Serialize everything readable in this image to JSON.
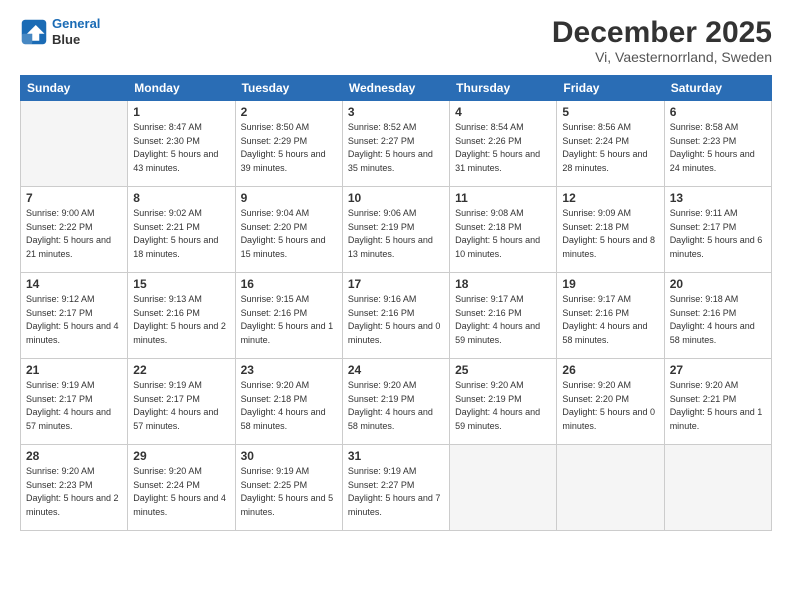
{
  "header": {
    "logo_line1": "General",
    "logo_line2": "Blue",
    "month": "December 2025",
    "location": "Vi, Vaesternorrland, Sweden"
  },
  "weekdays": [
    "Sunday",
    "Monday",
    "Tuesday",
    "Wednesday",
    "Thursday",
    "Friday",
    "Saturday"
  ],
  "weeks": [
    [
      {
        "day": "",
        "sunrise": "",
        "sunset": "",
        "daylight": ""
      },
      {
        "day": "1",
        "sunrise": "Sunrise: 8:47 AM",
        "sunset": "Sunset: 2:30 PM",
        "daylight": "Daylight: 5 hours and 43 minutes."
      },
      {
        "day": "2",
        "sunrise": "Sunrise: 8:50 AM",
        "sunset": "Sunset: 2:29 PM",
        "daylight": "Daylight: 5 hours and 39 minutes."
      },
      {
        "day": "3",
        "sunrise": "Sunrise: 8:52 AM",
        "sunset": "Sunset: 2:27 PM",
        "daylight": "Daylight: 5 hours and 35 minutes."
      },
      {
        "day": "4",
        "sunrise": "Sunrise: 8:54 AM",
        "sunset": "Sunset: 2:26 PM",
        "daylight": "Daylight: 5 hours and 31 minutes."
      },
      {
        "day": "5",
        "sunrise": "Sunrise: 8:56 AM",
        "sunset": "Sunset: 2:24 PM",
        "daylight": "Daylight: 5 hours and 28 minutes."
      },
      {
        "day": "6",
        "sunrise": "Sunrise: 8:58 AM",
        "sunset": "Sunset: 2:23 PM",
        "daylight": "Daylight: 5 hours and 24 minutes."
      }
    ],
    [
      {
        "day": "7",
        "sunrise": "Sunrise: 9:00 AM",
        "sunset": "Sunset: 2:22 PM",
        "daylight": "Daylight: 5 hours and 21 minutes."
      },
      {
        "day": "8",
        "sunrise": "Sunrise: 9:02 AM",
        "sunset": "Sunset: 2:21 PM",
        "daylight": "Daylight: 5 hours and 18 minutes."
      },
      {
        "day": "9",
        "sunrise": "Sunrise: 9:04 AM",
        "sunset": "Sunset: 2:20 PM",
        "daylight": "Daylight: 5 hours and 15 minutes."
      },
      {
        "day": "10",
        "sunrise": "Sunrise: 9:06 AM",
        "sunset": "Sunset: 2:19 PM",
        "daylight": "Daylight: 5 hours and 13 minutes."
      },
      {
        "day": "11",
        "sunrise": "Sunrise: 9:08 AM",
        "sunset": "Sunset: 2:18 PM",
        "daylight": "Daylight: 5 hours and 10 minutes."
      },
      {
        "day": "12",
        "sunrise": "Sunrise: 9:09 AM",
        "sunset": "Sunset: 2:18 PM",
        "daylight": "Daylight: 5 hours and 8 minutes."
      },
      {
        "day": "13",
        "sunrise": "Sunrise: 9:11 AM",
        "sunset": "Sunset: 2:17 PM",
        "daylight": "Daylight: 5 hours and 6 minutes."
      }
    ],
    [
      {
        "day": "14",
        "sunrise": "Sunrise: 9:12 AM",
        "sunset": "Sunset: 2:17 PM",
        "daylight": "Daylight: 5 hours and 4 minutes."
      },
      {
        "day": "15",
        "sunrise": "Sunrise: 9:13 AM",
        "sunset": "Sunset: 2:16 PM",
        "daylight": "Daylight: 5 hours and 2 minutes."
      },
      {
        "day": "16",
        "sunrise": "Sunrise: 9:15 AM",
        "sunset": "Sunset: 2:16 PM",
        "daylight": "Daylight: 5 hours and 1 minute."
      },
      {
        "day": "17",
        "sunrise": "Sunrise: 9:16 AM",
        "sunset": "Sunset: 2:16 PM",
        "daylight": "Daylight: 5 hours and 0 minutes."
      },
      {
        "day": "18",
        "sunrise": "Sunrise: 9:17 AM",
        "sunset": "Sunset: 2:16 PM",
        "daylight": "Daylight: 4 hours and 59 minutes."
      },
      {
        "day": "19",
        "sunrise": "Sunrise: 9:17 AM",
        "sunset": "Sunset: 2:16 PM",
        "daylight": "Daylight: 4 hours and 58 minutes."
      },
      {
        "day": "20",
        "sunrise": "Sunrise: 9:18 AM",
        "sunset": "Sunset: 2:16 PM",
        "daylight": "Daylight: 4 hours and 58 minutes."
      }
    ],
    [
      {
        "day": "21",
        "sunrise": "Sunrise: 9:19 AM",
        "sunset": "Sunset: 2:17 PM",
        "daylight": "Daylight: 4 hours and 57 minutes."
      },
      {
        "day": "22",
        "sunrise": "Sunrise: 9:19 AM",
        "sunset": "Sunset: 2:17 PM",
        "daylight": "Daylight: 4 hours and 57 minutes."
      },
      {
        "day": "23",
        "sunrise": "Sunrise: 9:20 AM",
        "sunset": "Sunset: 2:18 PM",
        "daylight": "Daylight: 4 hours and 58 minutes."
      },
      {
        "day": "24",
        "sunrise": "Sunrise: 9:20 AM",
        "sunset": "Sunset: 2:19 PM",
        "daylight": "Daylight: 4 hours and 58 minutes."
      },
      {
        "day": "25",
        "sunrise": "Sunrise: 9:20 AM",
        "sunset": "Sunset: 2:19 PM",
        "daylight": "Daylight: 4 hours and 59 minutes."
      },
      {
        "day": "26",
        "sunrise": "Sunrise: 9:20 AM",
        "sunset": "Sunset: 2:20 PM",
        "daylight": "Daylight: 5 hours and 0 minutes."
      },
      {
        "day": "27",
        "sunrise": "Sunrise: 9:20 AM",
        "sunset": "Sunset: 2:21 PM",
        "daylight": "Daylight: 5 hours and 1 minute."
      }
    ],
    [
      {
        "day": "28",
        "sunrise": "Sunrise: 9:20 AM",
        "sunset": "Sunset: 2:23 PM",
        "daylight": "Daylight: 5 hours and 2 minutes."
      },
      {
        "day": "29",
        "sunrise": "Sunrise: 9:20 AM",
        "sunset": "Sunset: 2:24 PM",
        "daylight": "Daylight: 5 hours and 4 minutes."
      },
      {
        "day": "30",
        "sunrise": "Sunrise: 9:19 AM",
        "sunset": "Sunset: 2:25 PM",
        "daylight": "Daylight: 5 hours and 5 minutes."
      },
      {
        "day": "31",
        "sunrise": "Sunrise: 9:19 AM",
        "sunset": "Sunset: 2:27 PM",
        "daylight": "Daylight: 5 hours and 7 minutes."
      },
      {
        "day": "",
        "sunrise": "",
        "sunset": "",
        "daylight": ""
      },
      {
        "day": "",
        "sunrise": "",
        "sunset": "",
        "daylight": ""
      },
      {
        "day": "",
        "sunrise": "",
        "sunset": "",
        "daylight": ""
      }
    ]
  ]
}
